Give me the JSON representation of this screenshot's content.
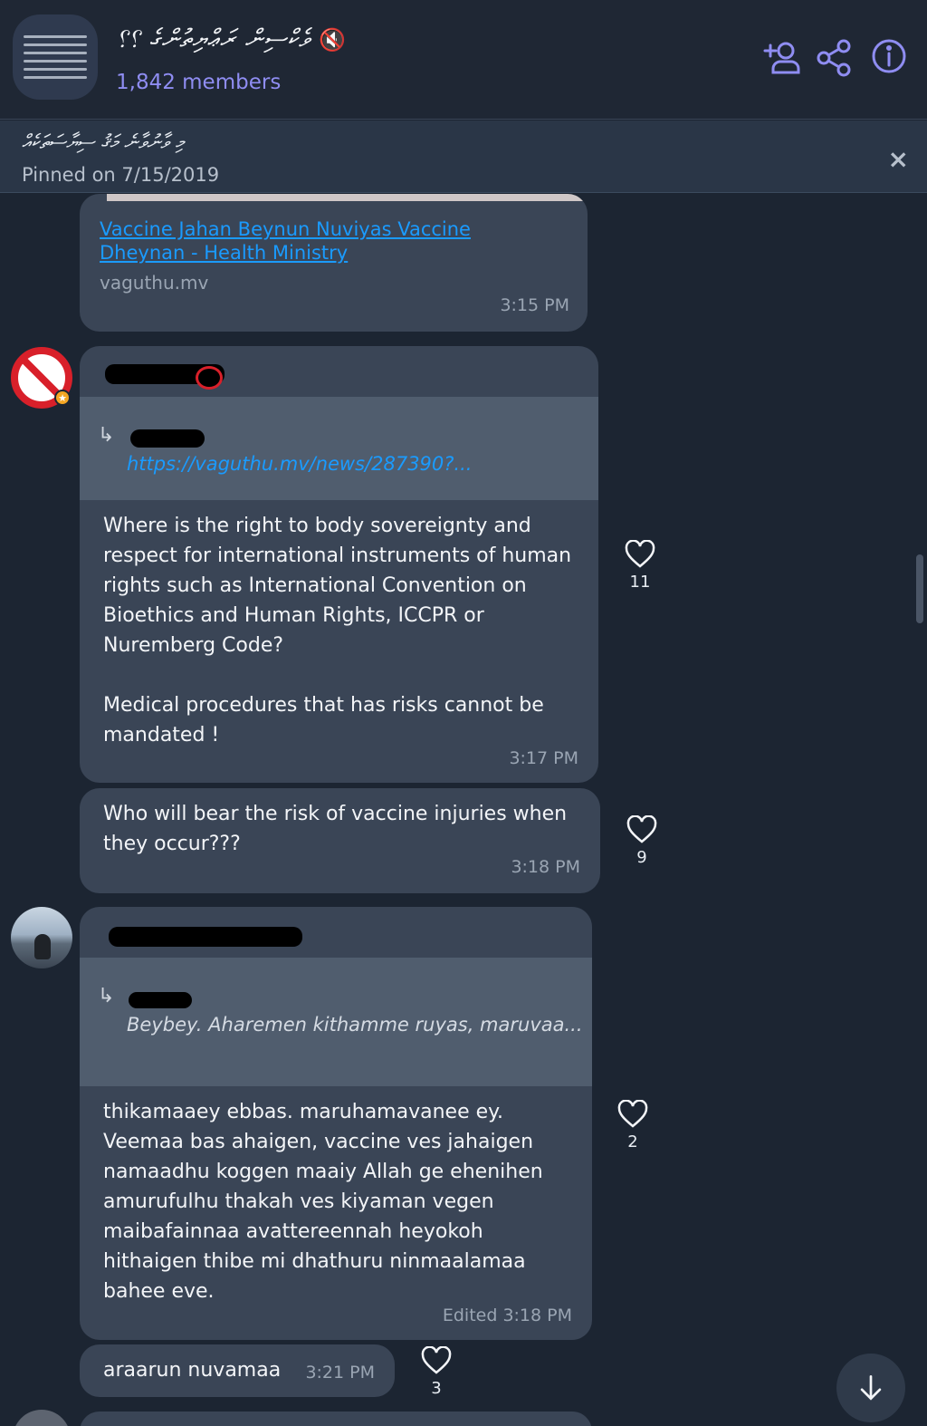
{
  "header": {
    "title": "ވެކްސިން ރަޢްޔިތުންގެ ؟؟",
    "mute_symbol": "🔇",
    "members": "1,842 members",
    "icons": [
      "add-member-icon",
      "share-icon",
      "info-icon"
    ]
  },
  "pinned": {
    "text": "މި ވާނުވާނެ މަޤު ސިޔާސަތަކެއް",
    "date": "Pinned on 7/15/2019",
    "close": "×"
  },
  "link_card": {
    "title": "Vaccine Jahan Beynun Nuviyas Vaccine Dheynan - Health Ministry",
    "domain": "vaguthu.mv",
    "time": "3:15 PM"
  },
  "messages": [
    {
      "reply_link": "https://vaguthu.mv/news/287390?...",
      "text": "Where is the right to body sovereignty and\nrespect for international instruments of human\nrights such as International Convention on\nBioethics and Human Rights, ICCPR or\nNuremberg Code?\n\nMedical procedures that has risks cannot be\nmandated !",
      "time": "3:17 PM",
      "reactions": "11"
    },
    {
      "text": "Who will bear the risk of vaccine injuries when\nthey occur???",
      "time": "3:18 PM",
      "reactions": "9"
    },
    {
      "reply_quote": "Beybey.\nAharemen kithamme ruyas, maruvaa...",
      "text": "thikamaaey ebbas. maruhamavanee ey.\nVeemaa bas  ahaigen, vaccine ves jahaigen\nnamaadhu koggen maaiy Allah ge ehenihen\namurufulhu thakah ves kiyaman vegen\nmaibafainnaa avattereennah heyokoh\nhithaigen thibe mi dhathuru ninmaalamaa\nbahee eve.",
      "time": "Edited 3:18 PM",
      "reactions": "2"
    },
    {
      "text": "araarun nuvamaa",
      "time": "3:21 PM",
      "reactions": "3"
    }
  ],
  "colors": {
    "background": "#1c2532",
    "bubble": "#3a4556",
    "accent": "#8f8df2",
    "link": "#1a9bff"
  }
}
